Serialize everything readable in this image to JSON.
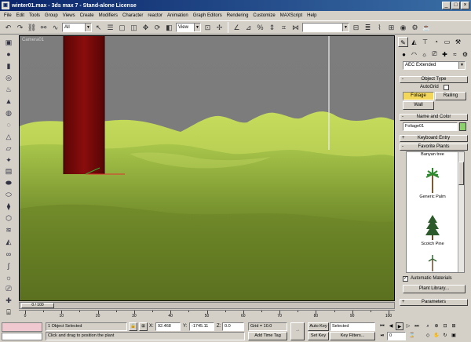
{
  "window": {
    "title": "winter01.max - 3ds max 7 - Stand-alone License",
    "app_icon": "3ds-max-icon"
  },
  "window_buttons": [
    "minimize-icon",
    "maximize-icon",
    "close-icon"
  ],
  "menu": [
    "File",
    "Edit",
    "Tools",
    "Group",
    "Views",
    "Create",
    "Modifiers",
    "Character",
    "reactor",
    "Animation",
    "Graph Editors",
    "Rendering",
    "Customize",
    "MAXScript",
    "Help"
  ],
  "toolbar": {
    "selection_filter": "All",
    "ref_coord": "View",
    "named_selection": ""
  },
  "viewport": {
    "label": "Camera01",
    "colors": {
      "sky": "#7c7c7c",
      "grass": "#8aa53a",
      "trunk": "#7a0a0a",
      "highlight": "#e0e0e0"
    }
  },
  "timeline": {
    "frame": "0 / 100",
    "ticks": [
      "0",
      "10",
      "20",
      "30",
      "40",
      "50",
      "60",
      "70",
      "80",
      "90",
      "100"
    ]
  },
  "status": {
    "selection": "1 Object Selected",
    "prompt": "Click and drag to position the plant",
    "x_label": "X:",
    "x_value": "92.468",
    "y_label": "Y:",
    "y_value": "-1745.11",
    "z_label": "Z:",
    "z_value": "0.0",
    "grid": "Grid = 10.0",
    "add_time_tag": "Add Time Tag",
    "auto_key": "Auto Key",
    "set_key": "Set Key",
    "key_mode": "Selected",
    "key_filters": "Key Filters...",
    "frame_value": "0"
  },
  "command_panel": {
    "category": "AEC Extended",
    "object_type": {
      "header": "Object Type",
      "autogrid": "AutoGrid",
      "buttons": [
        "Foliage",
        "Railing",
        "Wall"
      ],
      "active": "Foliage"
    },
    "name_and_color": {
      "header": "Name and Color",
      "name": "Foliage01",
      "color": "#8bd16a"
    },
    "keyboard_entry": "Keyboard Entry",
    "favorite_plants": {
      "header": "Favorite Plants",
      "items": [
        "Banyan tree",
        "Generic Palm",
        "Scotch Pine"
      ]
    },
    "automatic_materials": "Automatic Materials",
    "plant_library": "Plant Library...",
    "parameters": "Parameters"
  }
}
